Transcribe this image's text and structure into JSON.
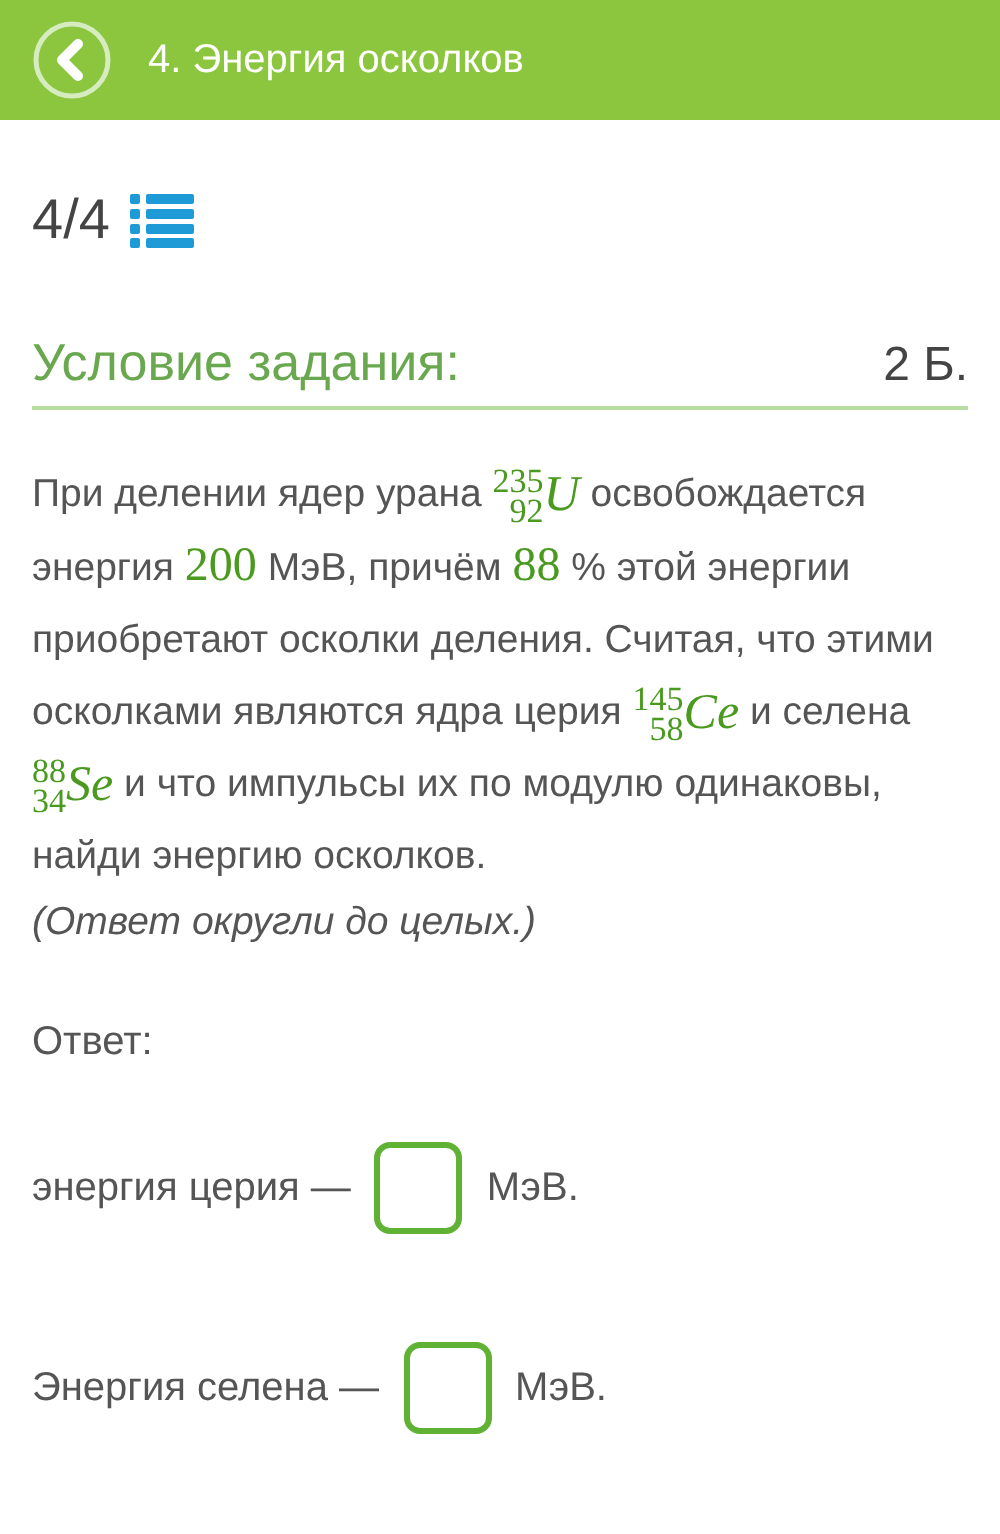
{
  "header": {
    "title": "4. Энергия осколков"
  },
  "progress": {
    "counter": "4/4"
  },
  "task": {
    "heading": "Условие задания:",
    "points": "2 Б."
  },
  "problem": [
    {
      "kind": "text",
      "text": "При делении ядер урана "
    },
    {
      "kind": "isotope",
      "mass": "235",
      "charge": "92",
      "symbol": "U"
    },
    {
      "kind": "text",
      "text": " освобождается энергия "
    },
    {
      "kind": "number",
      "text": "200"
    },
    {
      "kind": "text",
      "text": " МэВ, причём "
    },
    {
      "kind": "number",
      "text": "88"
    },
    {
      "kind": "text",
      "text": " % этой энергии приобретают осколки деления. Считая, что этими осколками являются ядра церия "
    },
    {
      "kind": "isotope",
      "mass": "145",
      "charge": "58",
      "symbol": "Ce"
    },
    {
      "kind": "text",
      "text": " и селена "
    },
    {
      "kind": "isotope",
      "mass": "88",
      "charge": "34",
      "symbol": "Se"
    },
    {
      "kind": "text",
      "text": " и что импульсы их по модулю одинаковы, найди энергию осколков."
    }
  ],
  "hint": "(Ответ округли до целых.)",
  "answer": {
    "label": "Ответ:",
    "fields": [
      {
        "label": "энергия церия —",
        "unit": "МэВ."
      },
      {
        "label": "Энергия селена —",
        "unit": "МэВ."
      }
    ]
  }
}
